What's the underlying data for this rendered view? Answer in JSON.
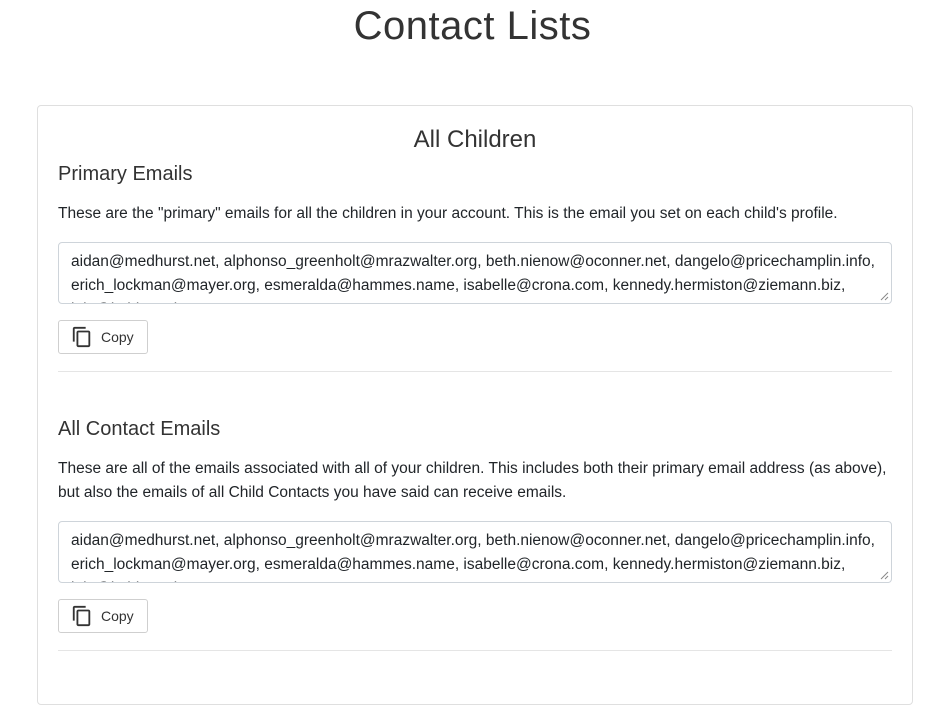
{
  "page": {
    "title": "Contact Lists"
  },
  "card": {
    "title": "All Children"
  },
  "sections": [
    {
      "heading": "Primary Emails",
      "description": "These are the \"primary\" emails for all the children in your account. This is the email you set on each child's profile.",
      "emails": "aidan@medhurst.net, alphonso_greenholt@mrazwalter.org, beth.nienow@oconner.net, dangelo@pricechamplin.info, erich_lockman@mayer.org, esmeralda@hammes.name, isabelle@crona.com, kennedy.hermiston@ziemann.biz, lela@kuhlman.io",
      "copy_label": "Copy"
    },
    {
      "heading": "All Contact Emails",
      "description": "These are all of the emails associated with all of your children. This includes both their primary email address (as above), but also the emails of all Child Contacts you have said can receive emails.",
      "emails": "aidan@medhurst.net, alphonso_greenholt@mrazwalter.org, beth.nienow@oconner.net, dangelo@pricechamplin.info, erich_lockman@mayer.org, esmeralda@hammes.name, isabelle@crona.com, kennedy.hermiston@ziemann.biz, lela@kuhlman.io",
      "copy_label": "Copy"
    }
  ],
  "icons": {
    "copy": "copy-icon"
  }
}
